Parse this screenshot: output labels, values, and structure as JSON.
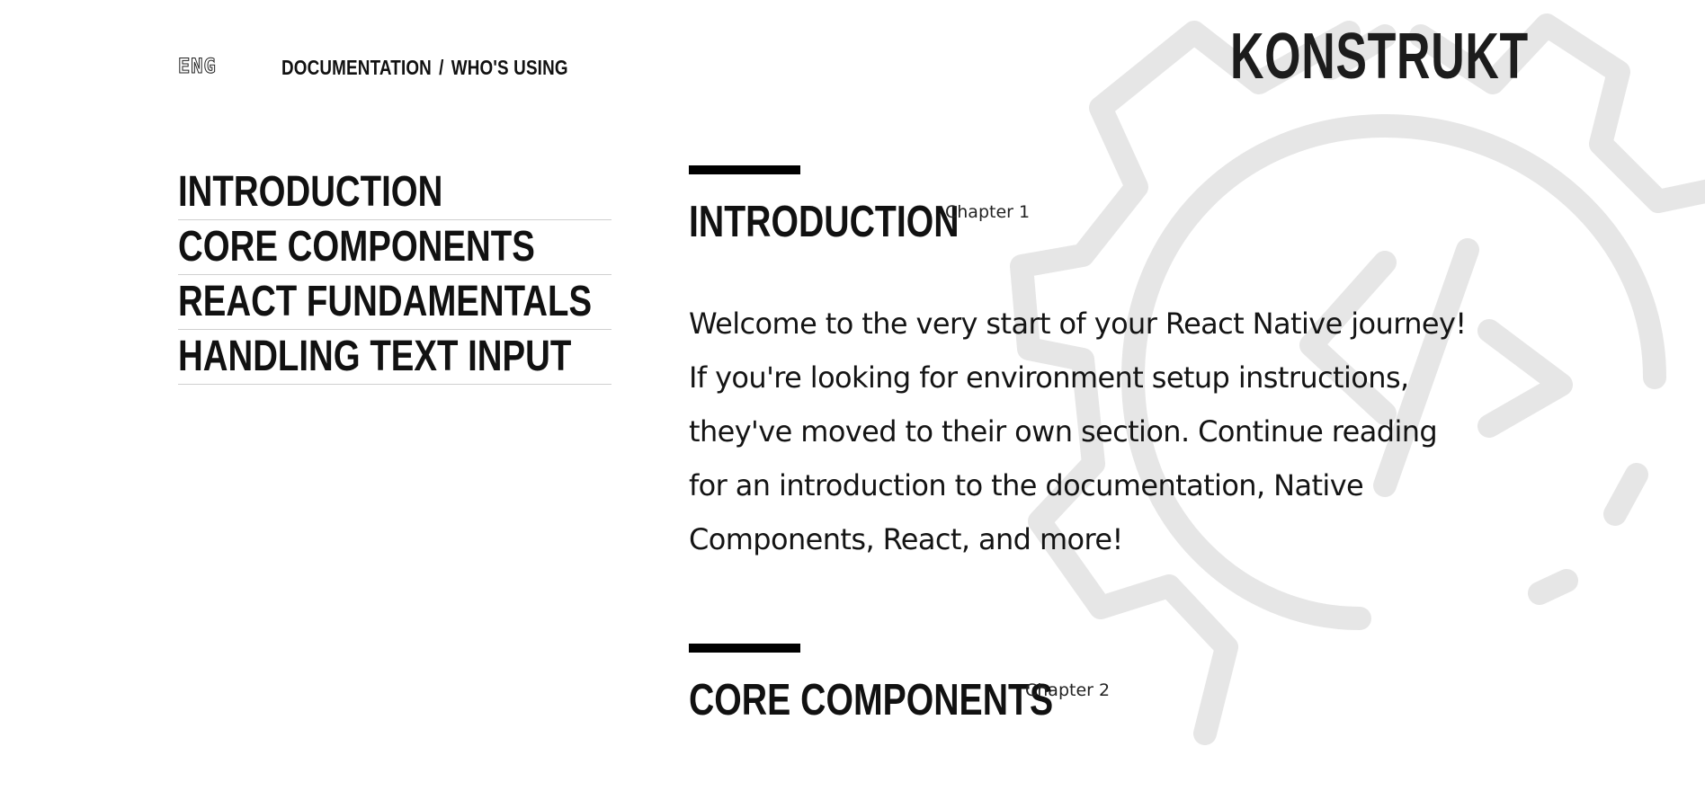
{
  "header": {
    "lang": "ENG",
    "nav": {
      "documentation": "DOCUMENTATION",
      "separator": "/",
      "whos_using": "WHO'S USING"
    },
    "logo": "KONSTRUKT"
  },
  "sidebar": {
    "items": [
      {
        "label": "INTRODUCTION"
      },
      {
        "label": "CORE COMPONENTS"
      },
      {
        "label": "REACT FUNDAMENTALS"
      },
      {
        "label": "HANDLING TEXT INPUT"
      }
    ]
  },
  "main": {
    "chapters": [
      {
        "title": "INTRODUCTION",
        "label": "Chapter 1",
        "body": "Welcome to the very start of your React Native journey! If you're looking for environment setup instructions, they've moved to their own section. Continue reading for an introduction to the documentation, Native Components, React, and more!"
      },
      {
        "title": "CORE COMPONENTS",
        "label": "Chapter 2"
      }
    ]
  },
  "decoration": {
    "background_icon": "gear-code-icon",
    "gear_color": "#e6e6e6",
    "accent": "#000000"
  }
}
